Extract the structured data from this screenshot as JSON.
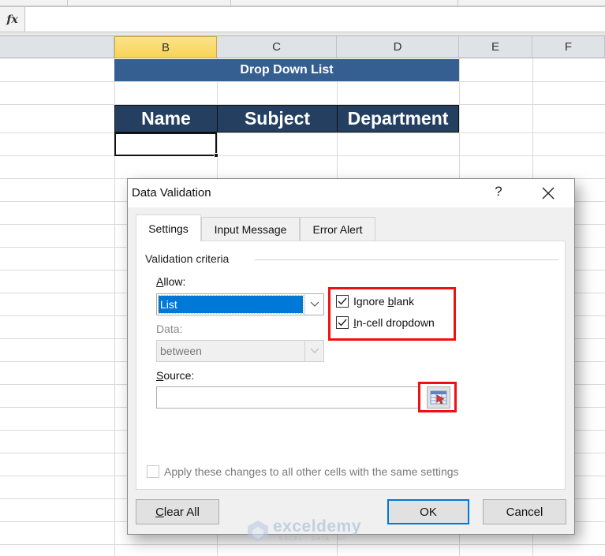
{
  "formula_bar": {
    "fx_label": "fx",
    "value": ""
  },
  "columns": [
    {
      "label": "B",
      "active": true
    },
    {
      "label": "C",
      "active": false
    },
    {
      "label": "D",
      "active": false
    },
    {
      "label": "E",
      "active": false
    },
    {
      "label": "F",
      "active": false
    }
  ],
  "sheet": {
    "title": "Drop Down List",
    "table_headers": [
      "Name",
      "Subject",
      "Department"
    ],
    "selected_cell_value": ""
  },
  "dialog": {
    "title": "Data Validation",
    "help_label": "?",
    "tabs": [
      {
        "label": "Settings",
        "active": true
      },
      {
        "label": "Input Message",
        "active": false
      },
      {
        "label": "Error Alert",
        "active": false
      }
    ],
    "group_label": "Validation criteria",
    "allow": {
      "label_accel": "A",
      "label_rest": "llow:",
      "value": "List"
    },
    "data": {
      "label": "Data:",
      "value": "between",
      "disabled": true
    },
    "ignore_blank": {
      "label_pre": "Ignore ",
      "label_accel": "b",
      "label_post": "lank",
      "checked": true
    },
    "in_cell_dropdown": {
      "label_accel": "I",
      "label_rest": "n-cell dropdown",
      "checked": true
    },
    "source": {
      "label_accel": "S",
      "label_rest": "ource:",
      "value": ""
    },
    "apply_all": {
      "label": "Apply these changes to all other cells with the same settings",
      "checked": false,
      "disabled": true
    },
    "buttons": {
      "clear_all_accel": "C",
      "clear_all_rest": "lear All",
      "ok": "OK",
      "cancel": "Cancel"
    }
  },
  "watermark": {
    "name": "exceldemy",
    "tagline": "EXCEL · DATA · BI"
  },
  "colors": {
    "title_banner": "#355f91",
    "table_header": "#243f60",
    "highlight_box": "#ee1111",
    "selection_blue": "#0078d7"
  }
}
